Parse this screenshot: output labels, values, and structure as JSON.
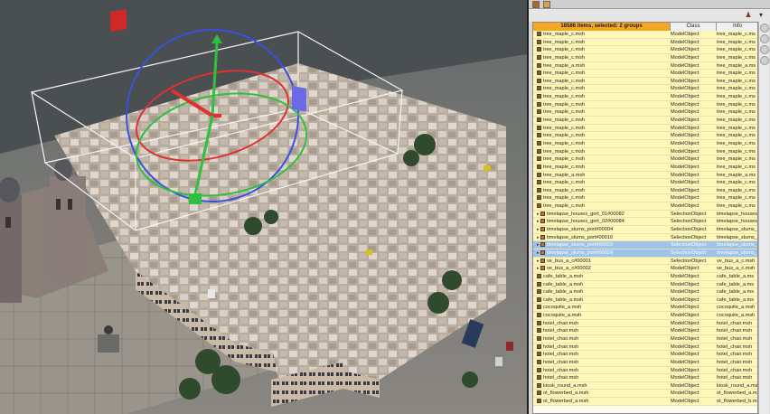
{
  "panel": {
    "header_summary": "18586 items, selected: 2 groups",
    "columns": [
      "",
      "Class",
      "Info"
    ],
    "rows": [
      {
        "name": "tree_maple_c.msh",
        "cls": "ModelObject",
        "info": "tree_maple_c.ms",
        "kind": "model",
        "sel": false
      },
      {
        "name": "tree_maple_c.msh",
        "cls": "ModelObject",
        "info": "tree_maple_c.ms",
        "kind": "model",
        "sel": false
      },
      {
        "name": "tree_maple_c.msh",
        "cls": "ModelObject",
        "info": "tree_maple_c.ms",
        "kind": "model",
        "sel": false
      },
      {
        "name": "tree_maple_c.msh",
        "cls": "ModelObject",
        "info": "tree_maple_c.ms",
        "kind": "model",
        "sel": false
      },
      {
        "name": "tree_maple_a.msh",
        "cls": "ModelObject",
        "info": "tree_maple_a.ms",
        "kind": "model",
        "sel": false
      },
      {
        "name": "tree_maple_c.msh",
        "cls": "ModelObject",
        "info": "tree_maple_c.ms",
        "kind": "model",
        "sel": false
      },
      {
        "name": "tree_maple_c.msh",
        "cls": "ModelObject",
        "info": "tree_maple_c.ms",
        "kind": "model",
        "sel": false
      },
      {
        "name": "tree_maple_c.msh",
        "cls": "ModelObject",
        "info": "tree_maple_c.ms",
        "kind": "model",
        "sel": false
      },
      {
        "name": "tree_maple_c.msh",
        "cls": "ModelObject",
        "info": "tree_maple_c.ms",
        "kind": "model",
        "sel": false
      },
      {
        "name": "tree_maple_c.msh",
        "cls": "ModelObject",
        "info": "tree_maple_c.ms",
        "kind": "model",
        "sel": false
      },
      {
        "name": "tree_maple_c.msh",
        "cls": "ModelObject",
        "info": "tree_maple_c.ms",
        "kind": "model",
        "sel": false
      },
      {
        "name": "tree_maple_c.msh",
        "cls": "ModelObject",
        "info": "tree_maple_c.ms",
        "kind": "model",
        "sel": false
      },
      {
        "name": "tree_maple_c.msh",
        "cls": "ModelObject",
        "info": "tree_maple_c.ms",
        "kind": "model",
        "sel": false
      },
      {
        "name": "tree_maple_c.msh",
        "cls": "ModelObject",
        "info": "tree_maple_c.ms",
        "kind": "model",
        "sel": false
      },
      {
        "name": "tree_maple_c.msh",
        "cls": "ModelObject",
        "info": "tree_maple_c.ms",
        "kind": "model",
        "sel": false
      },
      {
        "name": "tree_maple_c.msh",
        "cls": "ModelObject",
        "info": "tree_maple_c.ms",
        "kind": "model",
        "sel": false
      },
      {
        "name": "tree_maple_c.msh",
        "cls": "ModelObject",
        "info": "tree_maple_c.ms",
        "kind": "model",
        "sel": false
      },
      {
        "name": "tree_maple_c.msh",
        "cls": "ModelObject",
        "info": "tree_maple_c.ms",
        "kind": "model",
        "sel": false
      },
      {
        "name": "tree_maple_a.msh",
        "cls": "ModelObject",
        "info": "tree_maple_a.ms",
        "kind": "model",
        "sel": false
      },
      {
        "name": "tree_maple_c.msh",
        "cls": "ModelObject",
        "info": "tree_maple_c.ms",
        "kind": "model",
        "sel": false
      },
      {
        "name": "tree_maple_c.msh",
        "cls": "ModelObject",
        "info": "tree_maple_c.ms",
        "kind": "model",
        "sel": false
      },
      {
        "name": "tree_maple_c.msh",
        "cls": "ModelObject",
        "info": "tree_maple_c.ms",
        "kind": "model",
        "sel": false
      },
      {
        "name": "tree_maple_c.msh",
        "cls": "ModelObject",
        "info": "tree_maple_c.ms",
        "kind": "model",
        "sel": false
      },
      {
        "name": "timelapse_houses_gort_01#00082",
        "cls": "SelectionObject",
        "info": "timelapse_houses",
        "kind": "group",
        "sel": false
      },
      {
        "name": "timelapse_houses_gort_02#00084",
        "cls": "SelectionObject",
        "info": "timelapse_houses",
        "kind": "group",
        "sel": false
      },
      {
        "name": "timelapse_slums_port#00004",
        "cls": "SelectionObject",
        "info": "timelapse_slums_p",
        "kind": "group",
        "sel": false
      },
      {
        "name": "timelapse_slums_port#00010",
        "cls": "SelectionObject",
        "info": "timelapse_slums_p",
        "kind": "group",
        "sel": false
      },
      {
        "name": "timelapse_slums_port#00023",
        "cls": "SelectionObject",
        "info": "timelapse_slums_p",
        "kind": "group",
        "sel": true
      },
      {
        "name": "timelapse_slums_port#00029",
        "cls": "SelectionObject",
        "info": "timelapse_slums_p",
        "kind": "group",
        "sel": true
      },
      {
        "name": "ve_bus_a_c#00001",
        "cls": "SelectionObject",
        "info": "ve_bus_a_c.msh",
        "kind": "group",
        "sel": false
      },
      {
        "name": "ve_bus_a_c#00002",
        "cls": "ModelObject",
        "info": "ve_bus_a_c.msh",
        "kind": "group",
        "sel": false
      },
      {
        "name": "cafe_table_a.msh",
        "cls": "ModelObject",
        "info": "cafe_table_a.ms",
        "kind": "model",
        "sel": false
      },
      {
        "name": "cafe_table_a.msh",
        "cls": "ModelObject",
        "info": "cafe_table_a.ms",
        "kind": "model",
        "sel": false
      },
      {
        "name": "cafe_table_a.msh",
        "cls": "ModelObject",
        "info": "cafe_table_a.ms",
        "kind": "model",
        "sel": false
      },
      {
        "name": "cafe_table_a.msh",
        "cls": "ModelObject",
        "info": "cafe_table_a.ms",
        "kind": "model",
        "sel": false
      },
      {
        "name": "cocoquite_a.msh",
        "cls": "ModelObject",
        "info": "cocoquite_a.msh",
        "kind": "model",
        "sel": false
      },
      {
        "name": "cocoquite_a.msh",
        "cls": "ModelObject",
        "info": "cocoquite_a.msh",
        "kind": "model",
        "sel": false
      },
      {
        "name": "hotel_chair.msh",
        "cls": "ModelObject",
        "info": "hotel_chair.msh",
        "kind": "model",
        "sel": false
      },
      {
        "name": "hotel_chair.msh",
        "cls": "ModelObject",
        "info": "hotel_chair.msh",
        "kind": "model",
        "sel": false
      },
      {
        "name": "hotel_chair.msh",
        "cls": "ModelObject",
        "info": "hotel_chair.msh",
        "kind": "model",
        "sel": false
      },
      {
        "name": "hotel_chair.msh",
        "cls": "ModelObject",
        "info": "hotel_chair.msh",
        "kind": "model",
        "sel": false
      },
      {
        "name": "hotel_chair.msh",
        "cls": "ModelObject",
        "info": "hotel_chair.msh",
        "kind": "model",
        "sel": false
      },
      {
        "name": "hotel_chair.msh",
        "cls": "ModelObject",
        "info": "hotel_chair.msh",
        "kind": "model",
        "sel": false
      },
      {
        "name": "hotel_chair.msh",
        "cls": "ModelObject",
        "info": "hotel_chair.msh",
        "kind": "model",
        "sel": false
      },
      {
        "name": "hotel_chair.msh",
        "cls": "ModelObject",
        "info": "hotel_chair.msh",
        "kind": "model",
        "sel": false
      },
      {
        "name": "kiosk_round_a.msh",
        "cls": "ModelObject",
        "info": "kiosk_round_a.ms",
        "kind": "model",
        "sel": false
      },
      {
        "name": "ot_flowerbed_a.msh",
        "cls": "ModelObject",
        "info": "ot_flowerbed_a.ms",
        "kind": "model",
        "sel": false
      },
      {
        "name": "ot_flowerbed_a.msh",
        "cls": "ModelObject",
        "info": "ot_flowerbed_b.ms",
        "kind": "model",
        "sel": false
      }
    ]
  },
  "colors": {
    "row_bg": "#fff8b8",
    "row_selected": "#9ec3ea",
    "header_selected": "#f5a623",
    "gizmo_x": "#e03030",
    "gizmo_y": "#30c040",
    "gizmo_z": "#3a50e0"
  }
}
